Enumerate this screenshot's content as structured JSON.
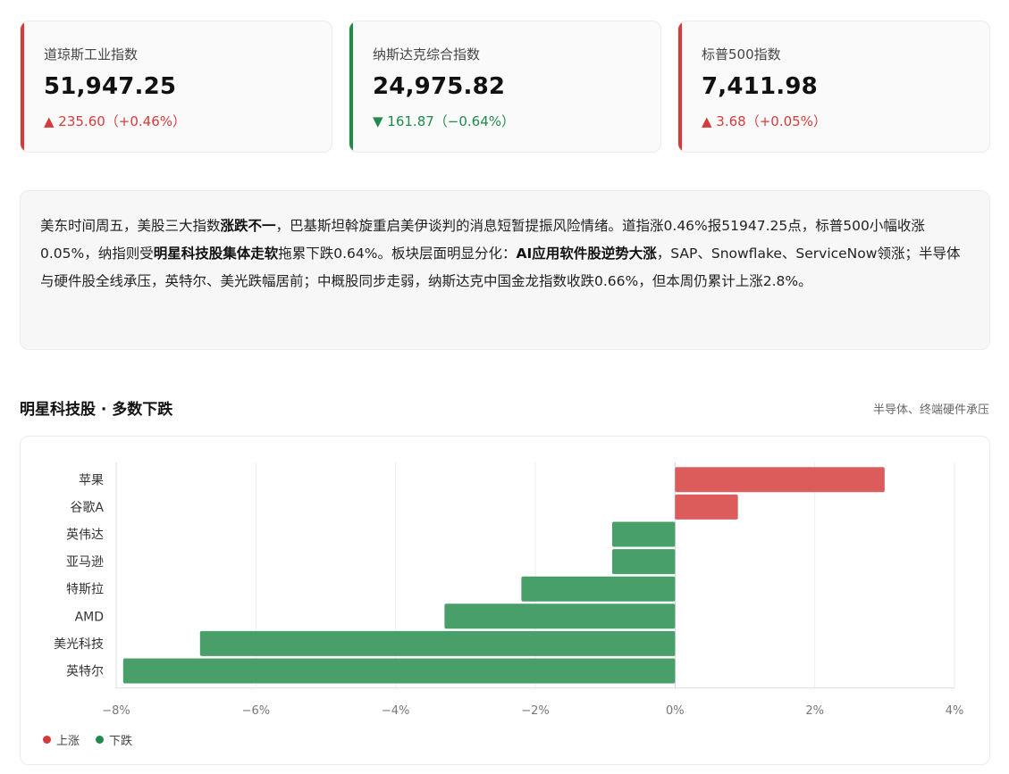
{
  "colors": {
    "up": "#d63b3b",
    "down": "#1f8a4c",
    "up_bar": "#dc5c5c",
    "down_bar": "#489f6a"
  },
  "cards": [
    {
      "name": "道琼斯工业指数",
      "value": "51,947.25",
      "change": "▲ 235.60（+0.46%）",
      "direction": "up"
    },
    {
      "name": "纳斯达克综合指数",
      "value": "24,975.82",
      "change": "▼ 161.87（−0.64%）",
      "direction": "down"
    },
    {
      "name": "标普500指数",
      "value": "7,411.98",
      "change": "▲ 3.68（+0.05%）",
      "direction": "up"
    }
  ],
  "summary": {
    "t1": "美东时间周五，美股三大指数",
    "b1": "涨跌不一",
    "t2": "，巴基斯坦斡旋重启美伊谈判的消息短暂提振风险情绪。道指涨0.46%报51947.25点，标普500小幅收涨0.05%，纳指则受",
    "b2": "明星科技股集体走软",
    "t3": "拖累下跌0.64%。板块层面明显分化：",
    "b3": "AI应用软件股逆势大涨",
    "t4": "，SAP、Snowflake、ServiceNow领涨；半导体与硬件股全线承压，英特尔、美光跌幅居前；中概股同步走弱，纳斯达克中国金龙指数收跌0.66%，但本周仍累计上涨2.8%。"
  },
  "chart_header": {
    "title": "明星科技股 · 多数下跌",
    "note": "半导体、终端硬件承压"
  },
  "legend": {
    "up": "上涨",
    "down": "下跌"
  },
  "chart_data": {
    "type": "bar",
    "orientation": "horizontal",
    "categories": [
      "苹果",
      "谷歌A",
      "英伟达",
      "亚马逊",
      "特斯拉",
      "AMD",
      "美光科技",
      "英特尔"
    ],
    "values": [
      3.0,
      0.9,
      -0.9,
      -0.9,
      -2.2,
      -3.3,
      -6.8,
      -7.9
    ],
    "xlim": [
      -8,
      4
    ],
    "xticks": [
      -8,
      -6,
      -4,
      -2,
      0,
      2,
      4
    ],
    "xtick_labels": [
      "−8%",
      "−6%",
      "−4%",
      "−2%",
      "0%",
      "2%",
      "4%"
    ],
    "grid": true,
    "legend": "bottom-left"
  }
}
